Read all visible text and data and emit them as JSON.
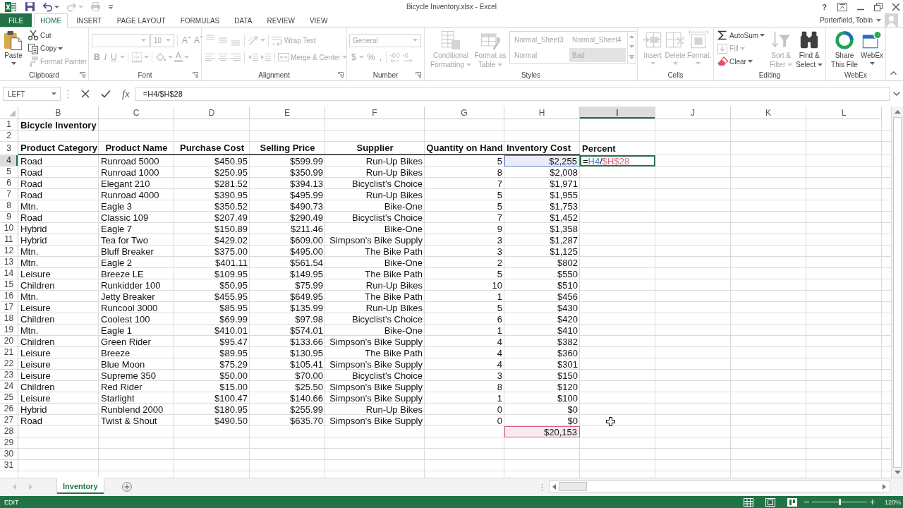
{
  "window": {
    "title": "Bicycle Inventory.xlsx - Excel",
    "help": "?",
    "user": "Porterfield, Tobin"
  },
  "quick_access": [
    {
      "kind": "save",
      "dropdown": false,
      "disabled": false
    },
    {
      "kind": "undo",
      "dropdown": true,
      "disabled": false
    },
    {
      "kind": "redo",
      "dropdown": true,
      "disabled": true
    },
    {
      "kind": "print",
      "dropdown": false,
      "disabled": true
    }
  ],
  "tabs": [
    {
      "label": "FILE",
      "kind": "backstage",
      "selected": false
    },
    {
      "label": "HOME",
      "kind": "tab",
      "selected": true
    },
    {
      "label": "INSERT",
      "kind": "tab",
      "selected": false
    },
    {
      "label": "PAGE LAYOUT",
      "kind": "tab",
      "selected": false
    },
    {
      "label": "FORMULAS",
      "kind": "tab",
      "selected": false
    },
    {
      "label": "DATA",
      "kind": "tab",
      "selected": false
    },
    {
      "label": "REVIEW",
      "kind": "tab",
      "selected": false
    },
    {
      "label": "VIEW",
      "kind": "tab",
      "selected": false
    }
  ],
  "ribbon": {
    "groups": [
      {
        "kind": "clipboard",
        "label": "Clipboard",
        "launcher": true,
        "sections": [
          {
            "kind": "large",
            "buttons": [
              {
                "kind": "paste",
                "label": "Paste",
                "dropdown": true,
                "disabled": false
              }
            ]
          },
          {
            "kind": "rows",
            "rows": [
              [
                {
                  "kind": "cut",
                  "label": "Cut",
                  "dropdown": false,
                  "disabled": false
                }
              ],
              [
                {
                  "kind": "copy",
                  "label": "Copy",
                  "dropdown": true,
                  "disabled": false
                }
              ],
              [
                {
                  "kind": "format_painter",
                  "label": "Format Painter",
                  "dropdown": false,
                  "disabled": true
                }
              ]
            ]
          }
        ]
      },
      {
        "kind": "font",
        "label": "Font",
        "launcher": true,
        "sections": [
          {
            "kind": "rows",
            "rows": [
              [
                {
                  "kind": "font_name",
                  "dropdown": true,
                  "disabled": true
                },
                {
                  "kind": "font_size",
                  "value": "10",
                  "dropdown": true,
                  "disabled": true
                },
                {
                  "kind": "grow_font",
                  "label": "A",
                  "dropdown": false,
                  "disabled": true
                },
                {
                  "kind": "shrink_font",
                  "label": "A",
                  "dropdown": false,
                  "disabled": true
                }
              ],
              [
                {
                  "kind": "bold",
                  "label": "B",
                  "dropdown": false,
                  "disabled": true
                },
                {
                  "kind": "italic",
                  "label": "I",
                  "dropdown": false,
                  "disabled": true
                },
                {
                  "kind": "underline",
                  "label": "U",
                  "dropdown": true,
                  "disabled": true
                },
                {
                  "kind": "borders",
                  "dropdown": true,
                  "disabled": true
                },
                {
                  "kind": "fill_color",
                  "dropdown": true,
                  "disabled": true
                },
                {
                  "kind": "font_color",
                  "label": "A",
                  "dropdown": true,
                  "disabled": true
                }
              ]
            ]
          }
        ]
      },
      {
        "kind": "alignment",
        "label": "Alignment",
        "launcher": true,
        "sections": [
          {
            "kind": "rows",
            "rows": [
              [
                {
                  "kind": "align_top",
                  "dropdown": false,
                  "disabled": true
                },
                {
                  "kind": "align_middle",
                  "dropdown": false,
                  "disabled": true
                },
                {
                  "kind": "align_bottom",
                  "dropdown": false,
                  "disabled": true
                },
                {
                  "kind": "orientation",
                  "dropdown": true,
                  "disabled": true
                },
                {
                  "kind": "wrap_text",
                  "label": "Wrap Text",
                  "dropdown": false,
                  "disabled": true
                }
              ],
              [
                {
                  "kind": "align_left",
                  "dropdown": false,
                  "disabled": true
                },
                {
                  "kind": "align_center",
                  "dropdown": false,
                  "disabled": true
                },
                {
                  "kind": "align_right",
                  "dropdown": false,
                  "disabled": true
                },
                {
                  "kind": "decrease_indent",
                  "dropdown": false,
                  "disabled": true
                },
                {
                  "kind": "increase_indent",
                  "dropdown": false,
                  "disabled": true
                },
                {
                  "kind": "merge_center",
                  "label": "Merge & Center",
                  "dropdown": true,
                  "disabled": true
                }
              ]
            ]
          }
        ]
      },
      {
        "kind": "number",
        "label": "Number",
        "launcher": true,
        "sections": [
          {
            "kind": "rows",
            "rows": [
              [
                {
                  "kind": "number_format",
                  "value": "General",
                  "dropdown": true,
                  "disabled": true
                }
              ],
              [
                {
                  "kind": "currency",
                  "label": "$",
                  "dropdown": true,
                  "disabled": true
                },
                {
                  "kind": "percent",
                  "label": "%",
                  "dropdown": false,
                  "disabled": true
                },
                {
                  "kind": "comma",
                  "label": ",",
                  "dropdown": false,
                  "disabled": true
                },
                {
                  "kind": "increase_decimal",
                  "dropdown": false,
                  "disabled": true
                },
                {
                  "kind": "decrease_decimal",
                  "dropdown": false,
                  "disabled": true
                }
              ]
            ]
          }
        ]
      },
      {
        "kind": "styles",
        "label": "Styles",
        "launcher": false,
        "sections": [
          {
            "kind": "large",
            "buttons": [
              {
                "kind": "conditional_formatting",
                "label": "Conditional Formatting",
                "dropdown": true,
                "disabled": true
              },
              {
                "kind": "format_as_table",
                "label": "Format as Table",
                "dropdown": true,
                "disabled": true
              }
            ]
          },
          {
            "kind": "gallery",
            "disabled": true,
            "styles": [
              {
                "kind": "normal",
                "label": "Normal_Sheet3"
              },
              {
                "kind": "normal",
                "label": "Normal_Sheet4"
              },
              {
                "kind": "normal",
                "label": "Normal"
              },
              {
                "kind": "bad",
                "label": "Bad"
              }
            ]
          }
        ]
      },
      {
        "kind": "cells",
        "label": "Cells",
        "launcher": false,
        "sections": [
          {
            "kind": "large",
            "buttons": [
              {
                "kind": "insert",
                "label": "Insert",
                "dropdown": true,
                "disabled": true
              },
              {
                "kind": "delete",
                "label": "Delete",
                "dropdown": true,
                "disabled": true
              },
              {
                "kind": "format",
                "label": "Format",
                "dropdown": true,
                "disabled": true
              }
            ]
          }
        ]
      },
      {
        "kind": "editing",
        "label": "Editing",
        "launcher": false,
        "sections": [
          {
            "kind": "rows",
            "rows": [
              [
                {
                  "kind": "autosum",
                  "label": "AutoSum",
                  "dropdown": true,
                  "disabled": false
                }
              ],
              [
                {
                  "kind": "fill",
                  "label": "Fill",
                  "dropdown": true,
                  "disabled": true
                }
              ],
              [
                {
                  "kind": "clear",
                  "label": "Clear",
                  "dropdown": true,
                  "disabled": false
                }
              ]
            ]
          },
          {
            "kind": "large",
            "buttons": [
              {
                "kind": "sort_filter",
                "label": "Sort & Filter",
                "dropdown": true,
                "disabled": true
              },
              {
                "kind": "find_select",
                "label": "Find & Select",
                "dropdown": true,
                "disabled": false
              }
            ]
          }
        ]
      },
      {
        "kind": "webex",
        "label": "WebEx",
        "launcher": false,
        "sections": [
          {
            "kind": "large",
            "buttons": [
              {
                "kind": "share",
                "label": "Share This File",
                "dropdown": false,
                "disabled": false
              },
              {
                "kind": "webex",
                "label": "WebEx",
                "dropdown": true,
                "disabled": false
              }
            ]
          }
        ]
      }
    ]
  },
  "formula_bar": {
    "name_box": "LEFT",
    "function_label": "fx",
    "formula": "=H4/$H$28"
  },
  "sheet": {
    "columns": [
      {
        "label": "B",
        "selected": false
      },
      {
        "label": "C",
        "selected": false
      },
      {
        "label": "D",
        "selected": false
      },
      {
        "label": "E",
        "selected": false
      },
      {
        "label": "F",
        "selected": false
      },
      {
        "label": "G",
        "selected": false
      },
      {
        "label": "H",
        "selected": false
      },
      {
        "label": "I",
        "selected": true
      },
      {
        "label": "J",
        "selected": false
      },
      {
        "label": "K",
        "selected": false
      },
      {
        "label": "L",
        "selected": false
      }
    ],
    "rows": [
      {
        "kind": "title",
        "number": "1",
        "selected": false,
        "title": "Bicycle Inventory"
      },
      {
        "kind": "blank",
        "number": "2",
        "selected": false
      },
      {
        "kind": "header",
        "number": "3",
        "selected": false,
        "labels": [
          "Product Category",
          "Product Name",
          "Purchase Cost",
          "Selling Price",
          "Supplier",
          "Quantity on Hand",
          "Inventory Cost",
          "Percent"
        ]
      },
      {
        "kind": "data",
        "number": "4",
        "selected": true,
        "values": [
          "Road",
          "Runroad 5000",
          "$450.95",
          "$599.99",
          "Run-Up Bikes",
          "5",
          "$2,255"
        ],
        "reference": {
          "color": "#5b7bd0"
        },
        "editor": [
          {
            "text": "="
          },
          {
            "text": "H4",
            "color": "#5b7bd0"
          },
          {
            "text": "/"
          },
          {
            "text": "$H$28",
            "color": "#d4607d"
          }
        ]
      },
      {
        "kind": "data",
        "number": "5",
        "selected": false,
        "values": [
          "Road",
          "Runroad 1000",
          "$250.95",
          "$350.99",
          "Run-Up Bikes",
          "8",
          "$2,008"
        ]
      },
      {
        "kind": "data",
        "number": "6",
        "selected": false,
        "values": [
          "Road",
          "Elegant 210",
          "$281.52",
          "$394.13",
          "Bicyclist's Choice",
          "7",
          "$1,971"
        ]
      },
      {
        "kind": "data",
        "number": "7",
        "selected": false,
        "values": [
          "Road",
          "Runroad 4000",
          "$390.95",
          "$495.99",
          "Run-Up Bikes",
          "5",
          "$1,955"
        ]
      },
      {
        "kind": "data",
        "number": "8",
        "selected": false,
        "values": [
          "Mtn.",
          "Eagle 3",
          "$350.52",
          "$490.73",
          "Bike-One",
          "5",
          "$1,753"
        ]
      },
      {
        "kind": "data",
        "number": "9",
        "selected": false,
        "values": [
          "Road",
          "Classic 109",
          "$207.49",
          "$290.49",
          "Bicyclist's Choice",
          "7",
          "$1,452"
        ]
      },
      {
        "kind": "data",
        "number": "10",
        "selected": false,
        "values": [
          "Hybrid",
          "Eagle 7",
          "$150.89",
          "$211.46",
          "Bike-One",
          "9",
          "$1,358"
        ]
      },
      {
        "kind": "data",
        "number": "11",
        "selected": false,
        "values": [
          "Hybrid",
          "Tea for Two",
          "$429.02",
          "$609.00",
          "Simpson's Bike Supply",
          "3",
          "$1,287"
        ]
      },
      {
        "kind": "data",
        "number": "12",
        "selected": false,
        "values": [
          "Mtn.",
          "Bluff Breaker",
          "$375.00",
          "$495.00",
          "The Bike Path",
          "3",
          "$1,125"
        ]
      },
      {
        "kind": "data",
        "number": "13",
        "selected": false,
        "values": [
          "Mtn.",
          "Eagle 2",
          "$401.11",
          "$561.54",
          "Bike-One",
          "2",
          "$802"
        ]
      },
      {
        "kind": "data",
        "number": "14",
        "selected": false,
        "values": [
          "Leisure",
          "Breeze LE",
          "$109.95",
          "$149.95",
          "The Bike Path",
          "5",
          "$550"
        ]
      },
      {
        "kind": "data",
        "number": "15",
        "selected": false,
        "values": [
          "Children",
          "Runkidder 100",
          "$50.95",
          "$75.99",
          "Run-Up Bikes",
          "10",
          "$510"
        ]
      },
      {
        "kind": "data",
        "number": "16",
        "selected": false,
        "values": [
          "Mtn.",
          "Jetty Breaker",
          "$455.95",
          "$649.95",
          "The Bike Path",
          "1",
          "$456"
        ]
      },
      {
        "kind": "data",
        "number": "17",
        "selected": false,
        "values": [
          "Leisure",
          "Runcool 3000",
          "$85.95",
          "$135.99",
          "Run-Up Bikes",
          "5",
          "$430"
        ]
      },
      {
        "kind": "data",
        "number": "18",
        "selected": false,
        "values": [
          "Children",
          "Coolest 100",
          "$69.99",
          "$97.98",
          "Bicyclist's Choice",
          "6",
          "$420"
        ]
      },
      {
        "kind": "data",
        "number": "19",
        "selected": false,
        "values": [
          "Mtn.",
          "Eagle 1",
          "$410.01",
          "$574.01",
          "Bike-One",
          "1",
          "$410"
        ]
      },
      {
        "kind": "data",
        "number": "20",
        "selected": false,
        "values": [
          "Children",
          "Green Rider",
          "$95.47",
          "$133.66",
          "Simpson's Bike Supply",
          "4",
          "$382"
        ]
      },
      {
        "kind": "data",
        "number": "21",
        "selected": false,
        "values": [
          "Leisure",
          "Breeze",
          "$89.95",
          "$130.95",
          "The Bike Path",
          "4",
          "$360"
        ]
      },
      {
        "kind": "data",
        "number": "22",
        "selected": false,
        "values": [
          "Leisure",
          "Blue Moon",
          "$75.29",
          "$105.41",
          "Simpson's Bike Supply",
          "4",
          "$301"
        ]
      },
      {
        "kind": "data",
        "number": "23",
        "selected": false,
        "values": [
          "Leisure",
          "Supreme 350",
          "$50.00",
          "$70.00",
          "Bicyclist's Choice",
          "3",
          "$150"
        ]
      },
      {
        "kind": "data",
        "number": "24",
        "selected": false,
        "values": [
          "Children",
          "Red Rider",
          "$15.00",
          "$25.50",
          "Simpson's Bike Supply",
          "8",
          "$120"
        ]
      },
      {
        "kind": "data",
        "number": "25",
        "selected": false,
        "values": [
          "Leisure",
          "Starlight",
          "$100.47",
          "$140.66",
          "Simpson's Bike Supply",
          "1",
          "$100"
        ]
      },
      {
        "kind": "data",
        "number": "26",
        "selected": false,
        "values": [
          "Hybrid",
          "Runblend 2000",
          "$180.95",
          "$255.99",
          "Run-Up Bikes",
          "0",
          "$0"
        ]
      },
      {
        "kind": "data",
        "number": "27",
        "selected": false,
        "values": [
          "Road",
          "Twist & Shout",
          "$490.50",
          "$635.70",
          "Simpson's Bike Supply",
          "0",
          "$0"
        ]
      },
      {
        "kind": "total",
        "number": "28",
        "selected": false,
        "total": "$20,153",
        "reference": {
          "color": "#d4607d"
        }
      },
      {
        "kind": "blank",
        "number": "29",
        "selected": false
      },
      {
        "kind": "blank",
        "number": "30",
        "selected": false
      },
      {
        "kind": "blank",
        "number": "31",
        "selected": false
      }
    ]
  },
  "sheet_tabs": [
    {
      "label": "Inventory",
      "selected": true
    }
  ],
  "status_bar": {
    "mode": "EDIT",
    "views": [
      {
        "kind": "normal"
      },
      {
        "kind": "page_layout"
      },
      {
        "kind": "page_break_preview"
      }
    ],
    "zoom_slider": {
      "level": 0.5
    },
    "zoom": "120%"
  }
}
